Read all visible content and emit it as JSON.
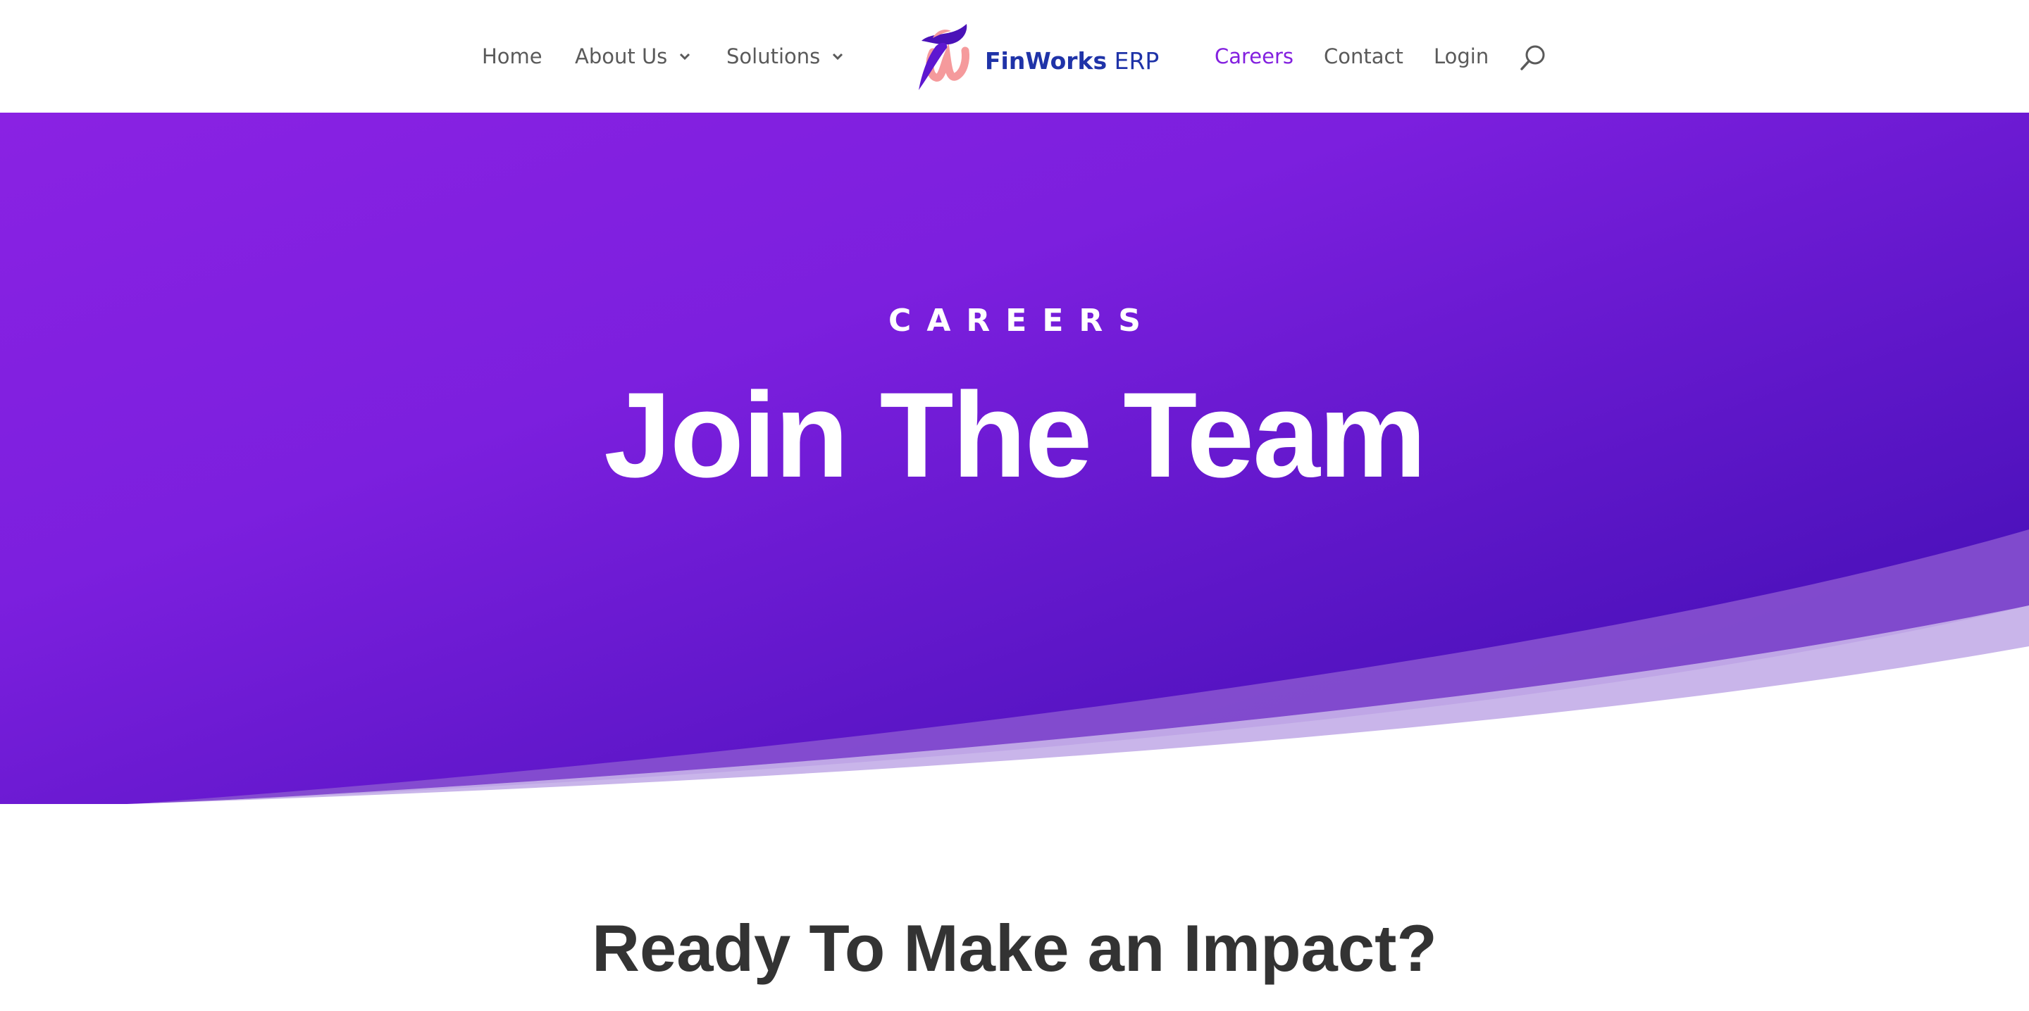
{
  "nav": {
    "home": "Home",
    "about": "About Us",
    "solutions": "Solutions",
    "careers": "Careers",
    "contact": "Contact",
    "login": "Login",
    "search_icon": "search-icon",
    "active_color": "#8320df"
  },
  "logo": {
    "brand": "FinWorks",
    "suffix": " ERP",
    "color": "#1f33a8"
  },
  "hero": {
    "eyebrow": "CAREERS",
    "title": "Join The Team",
    "gradient_start": "#8a22e3",
    "gradient_end": "#3f0cb0"
  },
  "section": {
    "title": "Ready To Make an Impact?"
  }
}
